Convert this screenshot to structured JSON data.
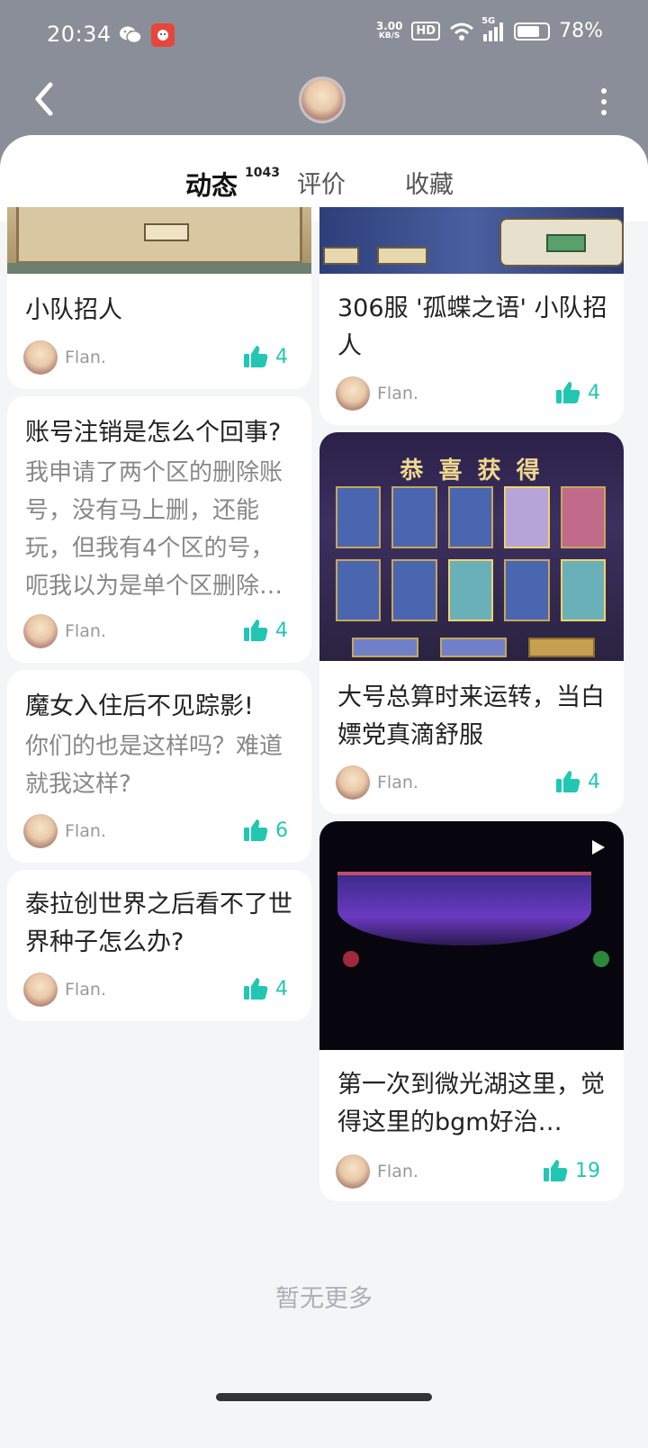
{
  "status_bar": {
    "time": "20:34",
    "net_speed_value": "3.00",
    "net_speed_unit": "KB/S",
    "hd_label": "HD",
    "network": "5G",
    "battery": "78%",
    "battery_level": 0.78
  },
  "header": {
    "back_icon": "chevron-left-icon",
    "more_icon": "more-vertical-icon"
  },
  "tabs": [
    {
      "label": "动态",
      "count": "1043",
      "active": true
    },
    {
      "label": "评价"
    },
    {
      "label": "收藏"
    }
  ],
  "posts_left": [
    {
      "title": "小队招人",
      "author": "Flan.",
      "likes": "4"
    },
    {
      "title": "账号注销是怎么个回事?",
      "desc": "我申请了两个区的删除账号，没有马上删，还能玩，但我有4个区的号，呃我以为是单个区删除…",
      "author": "Flan.",
      "likes": "4"
    },
    {
      "title": "魔女入住后不见踪影!",
      "desc": "你们的也是这样吗？难道就我这样?",
      "author": "Flan.",
      "likes": "6"
    },
    {
      "title": "泰拉创世界之后看不了世界种子怎么办?",
      "author": "Flan.",
      "likes": "4"
    }
  ],
  "posts_right": [
    {
      "title": "306服 '孤蝶之语' 小队招人",
      "author": "Flan.",
      "likes": "4"
    },
    {
      "title": "大号总算时来运转，当白嫖党真滴舒服",
      "author": "Flan.",
      "likes": "4",
      "image_text": "恭 喜 获 得"
    },
    {
      "title": "第一次到微光湖这里，觉得这里的bgm好治…",
      "author": "Flan.",
      "likes": "19"
    }
  ],
  "footer": {
    "no_more": "暂无更多"
  },
  "colors": {
    "accent": "#21c7b3",
    "header_bg": "#8a8e98",
    "page_bg": "#f4f5f7"
  }
}
